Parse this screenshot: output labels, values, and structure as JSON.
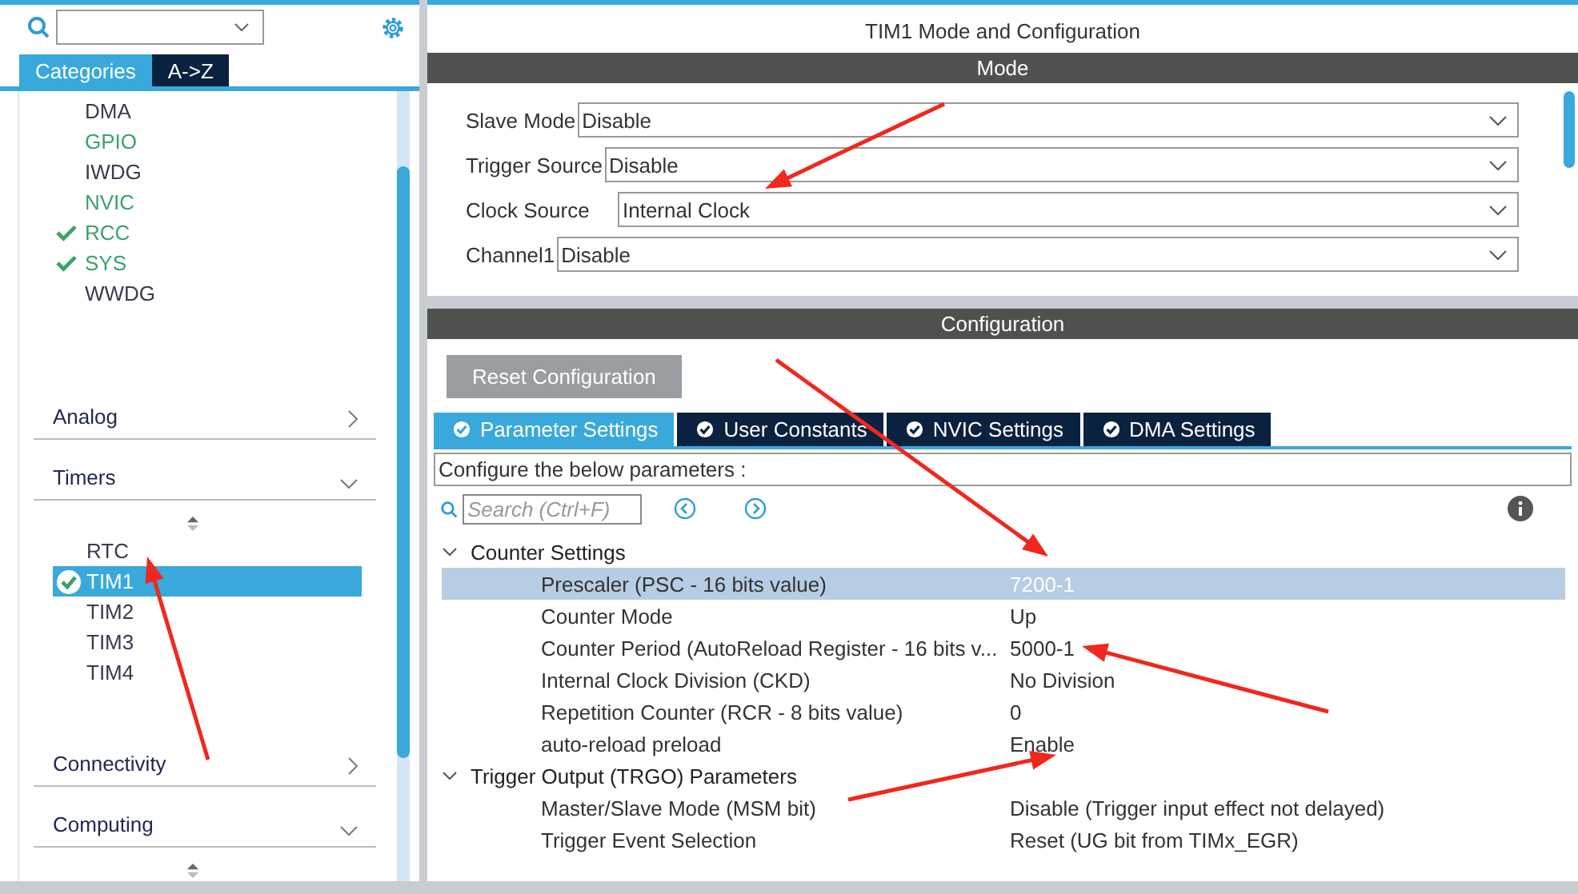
{
  "sidebar": {
    "tabs": [
      {
        "label": "Categories",
        "selected": true
      },
      {
        "label": "A->Z",
        "selected": false
      }
    ],
    "peripherals": [
      {
        "label": "DMA",
        "kind": "plain"
      },
      {
        "label": "GPIO",
        "kind": "available"
      },
      {
        "label": "IWDG",
        "kind": "plain"
      },
      {
        "label": "NVIC",
        "kind": "available"
      },
      {
        "label": "RCC",
        "kind": "configured"
      },
      {
        "label": "SYS",
        "kind": "configured"
      },
      {
        "label": "WWDG",
        "kind": "plain"
      }
    ],
    "categories": [
      {
        "label": "Analog",
        "expanded": false
      },
      {
        "label": "Timers",
        "expanded": true,
        "items": [
          {
            "label": "RTC",
            "selected": false,
            "configured": false
          },
          {
            "label": "TIM1",
            "selected": true,
            "configured": true
          },
          {
            "label": "TIM2",
            "selected": false,
            "configured": false
          },
          {
            "label": "TIM3",
            "selected": false,
            "configured": false
          },
          {
            "label": "TIM4",
            "selected": false,
            "configured": false
          }
        ]
      },
      {
        "label": "Connectivity",
        "expanded": false
      },
      {
        "label": "Computing",
        "expanded": true
      }
    ]
  },
  "main": {
    "title": "TIM1 Mode and Configuration",
    "mode": {
      "header": "Mode",
      "fields": [
        {
          "label": "Slave Mode",
          "value": "Disable"
        },
        {
          "label": "Trigger Source",
          "value": "Disable"
        },
        {
          "label": "Clock Source",
          "value": "Internal Clock"
        },
        {
          "label": "Channel1",
          "value": "Disable"
        }
      ]
    },
    "configuration": {
      "header": "Configuration",
      "reset_button": "Reset Configuration",
      "tabs": [
        {
          "label": "Parameter Settings",
          "selected": true
        },
        {
          "label": "User Constants",
          "selected": false
        },
        {
          "label": "NVIC Settings",
          "selected": false
        },
        {
          "label": "DMA Settings",
          "selected": false
        }
      ],
      "hint": "Configure the below parameters :",
      "search": {
        "placeholder": "Search (Ctrl+F)"
      },
      "groups": [
        {
          "label": "Counter Settings",
          "expanded": true,
          "params": [
            {
              "name": "Prescaler (PSC - 16 bits value)",
              "value": "7200-1",
              "selected": true
            },
            {
              "name": "Counter Mode",
              "value": "Up",
              "selected": false
            },
            {
              "name": "Counter Period (AutoReload Register - 16 bits v...",
              "value": "5000-1",
              "selected": false
            },
            {
              "name": "Internal Clock Division (CKD)",
              "value": "No Division",
              "selected": false
            },
            {
              "name": "Repetition Counter (RCR - 8 bits value)",
              "value": "0",
              "selected": false
            },
            {
              "name": "auto-reload preload",
              "value": "Enable",
              "selected": false
            }
          ]
        },
        {
          "label": "Trigger Output (TRGO) Parameters",
          "expanded": true,
          "params": [
            {
              "name": "Master/Slave Mode (MSM bit)",
              "value": "Disable (Trigger input effect not delayed)",
              "selected": false
            },
            {
              "name": "Trigger Event Selection",
              "value": "Reset (UG bit from TIMx_EGR)",
              "selected": false
            }
          ]
        }
      ]
    }
  }
}
